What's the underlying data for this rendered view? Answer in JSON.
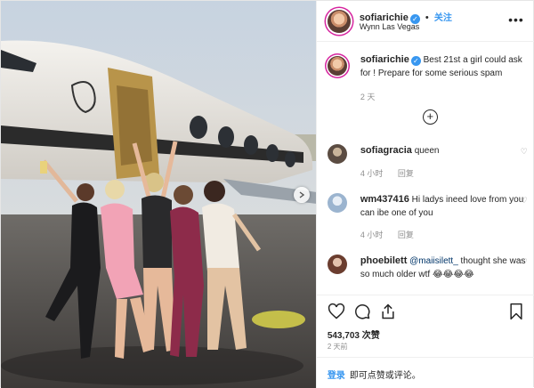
{
  "colors": {
    "accent": "#3897f0",
    "text": "#262626",
    "muted": "#8e8e8e",
    "border": "#efefef"
  },
  "post": {
    "author": "sofiarichie",
    "follow_label": "关注",
    "location": "Wynn Las Vegas",
    "verified_icon": "verified-badge-icon",
    "more_icon": "more-options-icon"
  },
  "caption": {
    "author": "sofiarichie",
    "text": "Best 21st a girl could ask for ! Prepare for some serious spam",
    "time": "2 天"
  },
  "load_more_icon": "plus-circle-icon",
  "comments": [
    {
      "user": "sofiagracia",
      "text": "queen",
      "time": "4 小时",
      "reply": "回复"
    },
    {
      "user": "wm437416",
      "text": "Hi ladys ineed love from you can ibe one of you",
      "time": "4 小时",
      "reply": "回复"
    },
    {
      "user": "phoebilett",
      "mention": "@maiisilett_",
      "text": "thought she was so much older wtf 😂😂😂😂",
      "time": "",
      "reply": ""
    }
  ],
  "actions": {
    "like_icon": "heart-icon",
    "comment_icon": "comment-icon",
    "share_icon": "share-icon",
    "save_icon": "bookmark-icon"
  },
  "likes": "543,703 次赞",
  "date": "2 天前",
  "login": {
    "link": "登录",
    "text": "即可点赞或评论。"
  }
}
